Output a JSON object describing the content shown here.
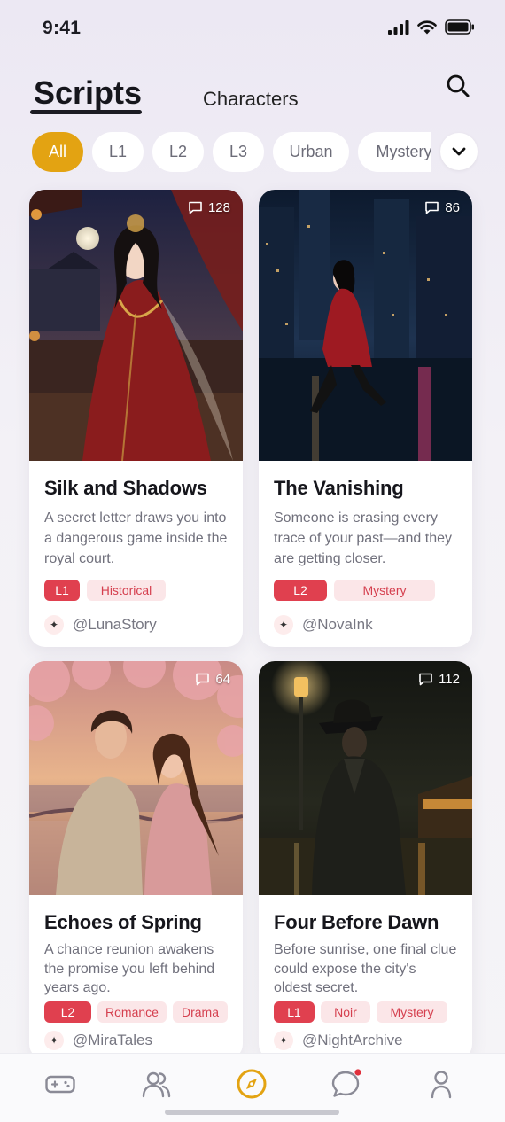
{
  "status_bar": {
    "time": "9:41"
  },
  "top_tabs": {
    "scripts": "Scripts",
    "characters": "Characters"
  },
  "filters": {
    "chips": [
      "All",
      "L1",
      "L2",
      "L3",
      "Urban",
      "Mystery"
    ],
    "active": "All"
  },
  "accent_color": "#e3a312",
  "tag_color": "#e0404f",
  "cards": [
    {
      "title": "Silk and Shadows",
      "description": "A secret letter draws you into a dangerous game inside the royal court.",
      "comments": "128",
      "level": "L1",
      "tags": [
        "Historical"
      ],
      "author": "@LunaStory"
    },
    {
      "title": "The Vanishing",
      "description": "Someone is erasing every trace of your past—and they are getting closer.",
      "comments": "86",
      "level": "L2",
      "tags": [
        "Mystery"
      ],
      "author": "@NovaInk"
    },
    {
      "title": "Echoes of Spring",
      "description": "A chance reunion awakens the promise you left behind years ago.",
      "comments": "64",
      "level": "L2",
      "tags": [
        "Romance",
        "Drama"
      ],
      "author": "@MiraTales"
    },
    {
      "title": "Four Before Dawn",
      "description": "Before sunrise, one final clue could expose the city's oldest secret.",
      "comments": "112",
      "level": "L1",
      "tags": [
        "Noir",
        "Mystery"
      ],
      "author": "@NightArchive"
    }
  ],
  "bottom_nav": {
    "items": [
      "games-icon",
      "people-icon",
      "compass-icon",
      "chat-icon",
      "profile-icon"
    ],
    "active": "compass-icon",
    "chat_has_notification": true
  }
}
